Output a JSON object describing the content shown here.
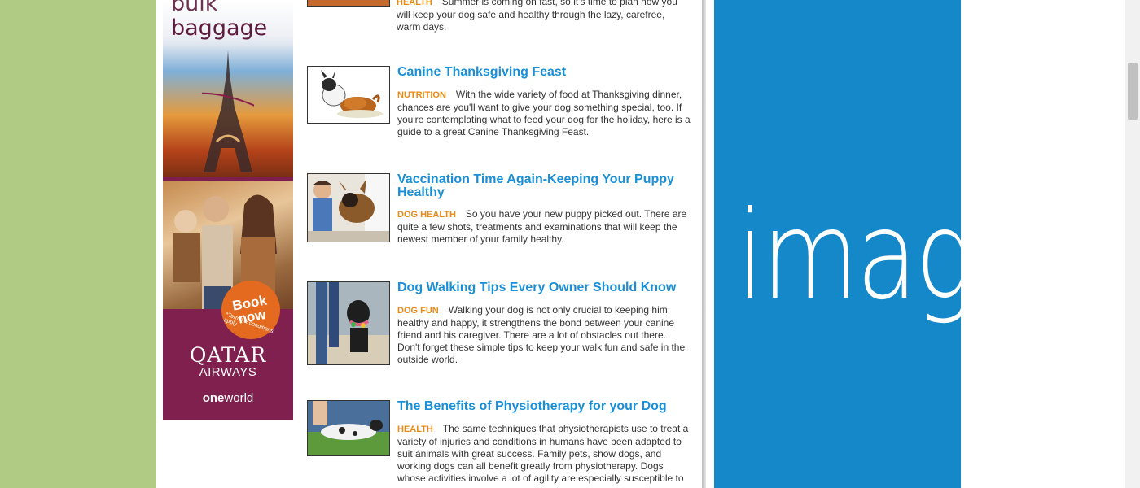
{
  "ad": {
    "headline_line1": "bulk",
    "headline_line2": "baggage",
    "cta_line1": "Book",
    "cta_line2": "now",
    "terms": "*Terms & conditions apply",
    "brand": "QATAR",
    "brand_sub": "AIRWAYS",
    "alliance_bold": "one",
    "alliance_rest": "world"
  },
  "articles": [
    {
      "title": "",
      "category": "HEALTH",
      "body_line1": "Summer is coming on fast, so it's time to plan how you",
      "body_rest": "will keep your dog safe and healthy through the lazy, carefree, warm days.",
      "image": "dog-photo"
    },
    {
      "title": "Canine Thanksgiving Feast",
      "category": "NUTRITION",
      "body": "With the wide variety of food at Thanksgiving dinner, chances are you'll want to give your dog something special, too. If you're contemplating what to feed your dog for the holiday, here is a guide to a great Canine Thanksgiving Feast.",
      "image": "dog-with-turkey"
    },
    {
      "title": "Vaccination Time Again-Keeping Your Puppy Healthy",
      "category": "DOG HEALTH",
      "body": "So you have your new puppy picked out. There are quite a few shots, treatments and examinations that will keep the newest member of your family healthy.",
      "image": "puppy-at-vet"
    },
    {
      "title": "Dog Walking Tips Every Owner Should Know",
      "category": "DOG FUN",
      "body": "Walking your dog is not only crucial to keeping him healthy and happy, it strengthens the bond between your canine friend and his caregiver. There are a lot of obstacles out there. Don't forget these simple tips to keep your walk fun and safe in the outside world.",
      "image": "dog-on-walk"
    },
    {
      "title": "The Benefits of Physiotherapy for your Dog",
      "category": "HEALTH",
      "body": "The same techniques that physiotherapists use to treat a variety of injuries and conditions in humans have been adapted to suit animals with great success. Family pets, show dogs, and working dogs can all benefit greatly from physiotherapy.  Dogs whose activities involve a lot of agility are especially susceptible to",
      "image": "dog-physiotherapy"
    }
  ],
  "placeholder": {
    "text": "image",
    "color": "#1488c8"
  },
  "colors": {
    "background": "#b0cc84",
    "title": "#1a8fd6",
    "category": "#e88a16"
  }
}
